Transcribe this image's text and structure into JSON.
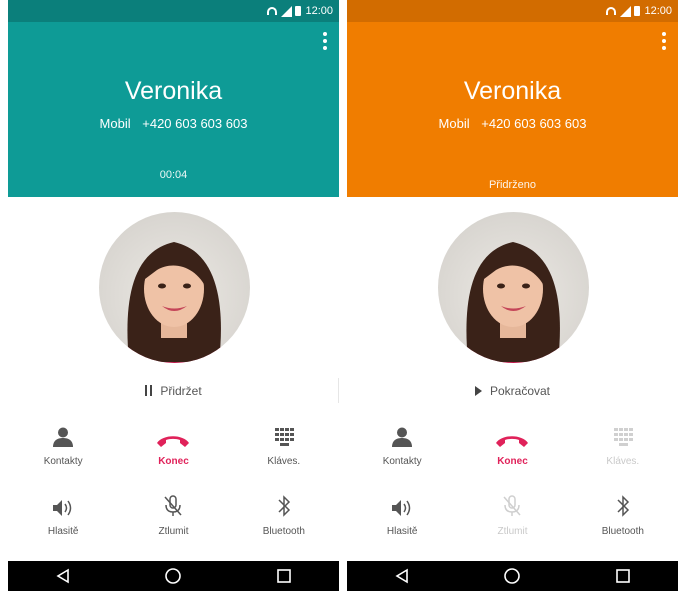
{
  "colors": {
    "left_header": "#0e9b96",
    "left_statusbar": "#0b7f7b",
    "right_header": "#f07d00",
    "right_statusbar": "#d26c00",
    "end_call": "#e0225a"
  },
  "left": {
    "status": {
      "time": "12:00"
    },
    "contact": {
      "name": "Veronika",
      "number_type": "Mobil",
      "number": "+420 603 603 603"
    },
    "call_state": "00:04",
    "hold_label": "Přidržet",
    "hold_icon": "pause-icon",
    "buttons": [
      {
        "label": "Kontakty",
        "icon": "person-icon",
        "disabled": false
      },
      {
        "label": "Konec",
        "icon": "end-call-icon",
        "disabled": false
      },
      {
        "label": "Kláves.",
        "icon": "keypad-icon",
        "disabled": false
      },
      {
        "label": "Hlasitě",
        "icon": "speaker-icon",
        "disabled": false
      },
      {
        "label": "Ztlumit",
        "icon": "mic-off-icon",
        "disabled": false
      },
      {
        "label": "Bluetooth",
        "icon": "bluetooth-icon",
        "disabled": false
      }
    ]
  },
  "right": {
    "status": {
      "time": "12:00"
    },
    "contact": {
      "name": "Veronika",
      "number_type": "Mobil",
      "number": "+420 603 603 603"
    },
    "call_state": "Přidrženo",
    "hold_label": "Pokračovat",
    "hold_icon": "play-icon",
    "buttons": [
      {
        "label": "Kontakty",
        "icon": "person-icon",
        "disabled": false
      },
      {
        "label": "Konec",
        "icon": "end-call-icon",
        "disabled": false
      },
      {
        "label": "Kláves.",
        "icon": "keypad-icon",
        "disabled": true
      },
      {
        "label": "Hlasitě",
        "icon": "speaker-icon",
        "disabled": false
      },
      {
        "label": "Ztlumit",
        "icon": "mic-off-icon",
        "disabled": true
      },
      {
        "label": "Bluetooth",
        "icon": "bluetooth-icon",
        "disabled": false
      }
    ]
  }
}
